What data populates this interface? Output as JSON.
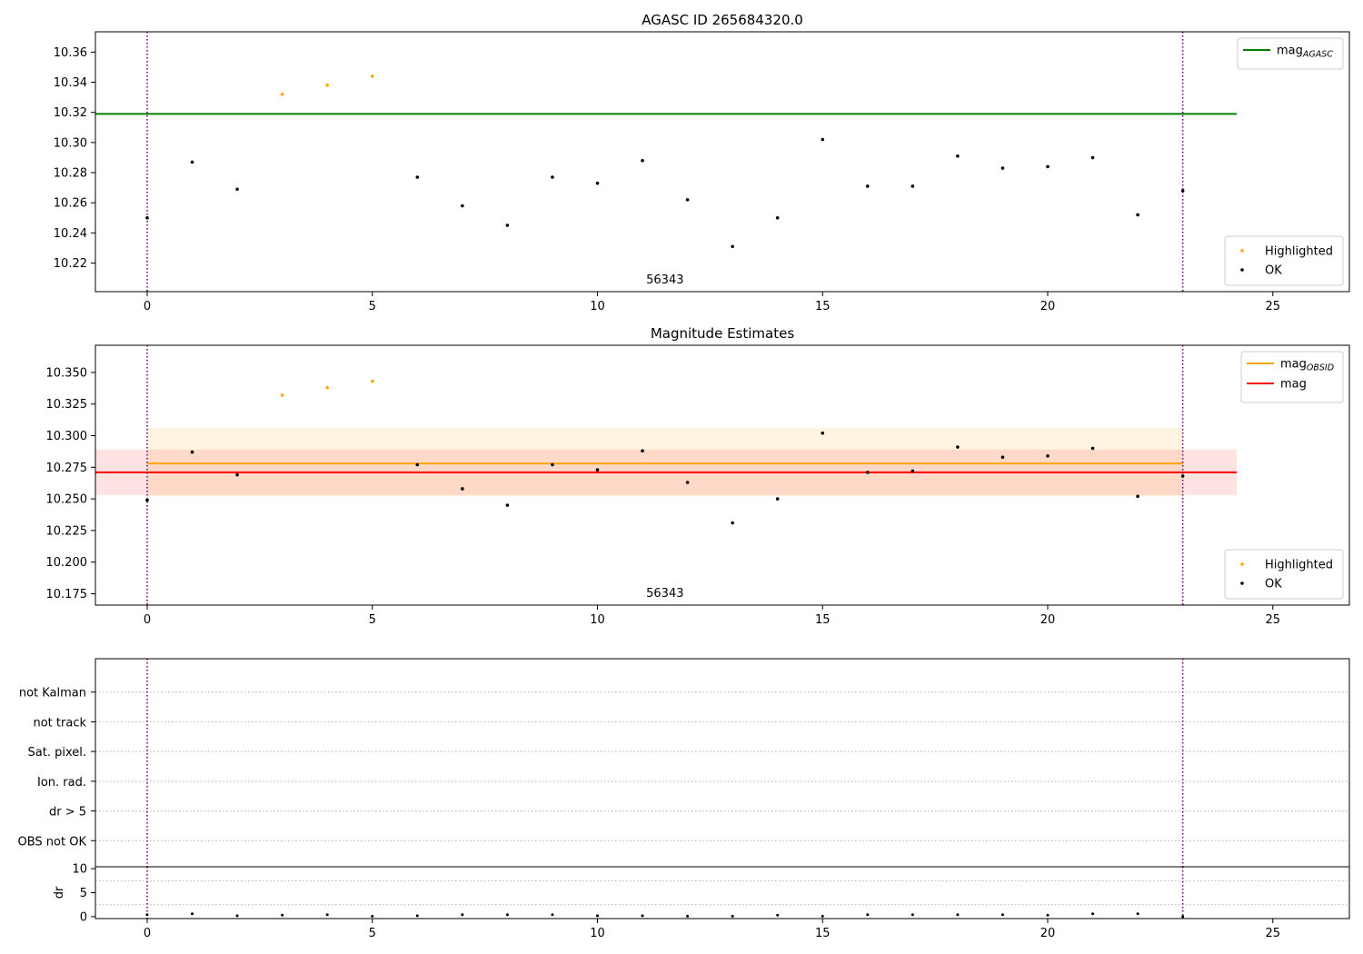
{
  "chart_data": [
    {
      "type": "scatter",
      "title": "AGASC ID 265684320.0",
      "xlim": [
        -1.15,
        26.7
      ],
      "ylim": [
        10.201,
        10.3735
      ],
      "xticks": [
        0,
        5,
        10,
        15,
        20,
        25
      ],
      "yticks": [
        10.22,
        10.24,
        10.26,
        10.28,
        10.3,
        10.32,
        10.34,
        10.36
      ],
      "ytick_decimals": 2,
      "vlines": [
        0,
        23
      ],
      "annotation": {
        "text": "56343",
        "x": 11.5
      },
      "hlines": [
        {
          "name": "mag",
          "subscript": "AGASC",
          "value": 10.319,
          "x_range": [
            -1.15,
            24.2
          ],
          "color": "#008000"
        }
      ],
      "bands": [],
      "line_legend": [
        {
          "label": "mag",
          "subscript": "AGASC",
          "color": "#008000"
        }
      ],
      "point_legend": [
        {
          "label": "Highlighted",
          "color": "#ffa500"
        },
        {
          "label": "OK",
          "color": "#000000"
        }
      ],
      "series": [
        {
          "name": "Highlighted",
          "color": "#ffa500",
          "x": [
            3,
            4,
            5
          ],
          "y": [
            10.332,
            10.338,
            10.344
          ]
        },
        {
          "name": "OK",
          "color": "#000000",
          "x": [
            0,
            1,
            2,
            6,
            7,
            8,
            9,
            10,
            11,
            12,
            13,
            14,
            15,
            16,
            17,
            18,
            19,
            20,
            21,
            22,
            23
          ],
          "y": [
            10.25,
            10.287,
            10.269,
            10.277,
            10.258,
            10.245,
            10.277,
            10.273,
            10.288,
            10.262,
            10.231,
            10.25,
            10.302,
            10.271,
            10.271,
            10.291,
            10.283,
            10.284,
            10.29,
            10.252,
            10.268
          ]
        }
      ]
    },
    {
      "type": "scatter",
      "title": "Magnitude Estimates",
      "xlim": [
        -1.15,
        26.7
      ],
      "ylim": [
        10.166,
        10.3715
      ],
      "xticks": [
        0,
        5,
        10,
        15,
        20,
        25
      ],
      "yticks": [
        10.175,
        10.2,
        10.225,
        10.25,
        10.275,
        10.3,
        10.325,
        10.35
      ],
      "ytick_decimals": 3,
      "vlines": [
        0,
        23
      ],
      "annotation": {
        "text": "56343",
        "x": 11.5
      },
      "bands": [
        {
          "low": 10.252,
          "high": 10.306,
          "x_range": [
            0,
            23
          ],
          "color": "#ffa500",
          "opacity": 0.12
        },
        {
          "low": 10.253,
          "high": 10.289,
          "x_range": [
            -1.15,
            24.2
          ],
          "color": "#ff0000",
          "opacity": 0.11
        }
      ],
      "hlines": [
        {
          "name": "mag",
          "subscript": "OBSID",
          "value": 10.278,
          "x_range": [
            0,
            23
          ],
          "color": "#ffa500"
        },
        {
          "name": "mag",
          "value": 10.271,
          "x_range": [
            -1.15,
            24.2
          ],
          "color": "#ff0000"
        }
      ],
      "line_legend": [
        {
          "label": "mag",
          "subscript": "OBSID",
          "color": "#ffa500"
        },
        {
          "label": "mag",
          "subscript": "",
          "color": "#ff0000"
        }
      ],
      "point_legend": [
        {
          "label": "Highlighted",
          "color": "#ffa500"
        },
        {
          "label": "OK",
          "color": "#000000"
        }
      ],
      "series": [
        {
          "name": "Highlighted",
          "color": "#ffa500",
          "x": [
            3,
            4,
            5
          ],
          "y": [
            10.332,
            10.338,
            10.343
          ]
        },
        {
          "name": "OK",
          "color": "#000000",
          "x": [
            0,
            1,
            2,
            6,
            7,
            8,
            9,
            10,
            11,
            12,
            13,
            14,
            15,
            16,
            17,
            18,
            19,
            20,
            21,
            22,
            23
          ],
          "y": [
            10.249,
            10.287,
            10.269,
            10.277,
            10.258,
            10.245,
            10.277,
            10.273,
            10.288,
            10.263,
            10.231,
            10.25,
            10.302,
            10.271,
            10.272,
            10.291,
            10.283,
            10.284,
            10.29,
            10.252,
            10.268
          ]
        }
      ]
    },
    {
      "type": "scatter",
      "title": "",
      "xlim": [
        -1.15,
        26.7
      ],
      "categories": [
        "OBS not OK",
        "dr > 5",
        "Ion. rad.",
        "Sat. pixel.",
        "not track",
        "not Kalman"
      ],
      "vlines": [
        0,
        23
      ],
      "series": []
    },
    {
      "type": "scatter",
      "title": "",
      "ylabel": "dr",
      "xlim": [
        -1.15,
        26.7
      ],
      "ylim": [
        -0.4,
        10.4
      ],
      "xticks": [
        0,
        5,
        10,
        15,
        20,
        25
      ],
      "yticks": [
        0,
        5,
        10
      ],
      "vlines": [
        0,
        23
      ],
      "series": [
        {
          "name": "",
          "color": "#000000",
          "x": [
            0,
            1,
            2,
            3,
            4,
            5,
            6,
            7,
            8,
            9,
            10,
            11,
            12,
            13,
            14,
            15,
            16,
            17,
            18,
            19,
            20,
            21,
            22,
            23
          ],
          "y": [
            0.4,
            0.6,
            0.2,
            0.3,
            0.4,
            0.1,
            0.2,
            0.4,
            0.4,
            0.4,
            0.2,
            0.2,
            0.1,
            0.1,
            0.3,
            0.1,
            0.4,
            0.4,
            0.4,
            0.4,
            0.3,
            0.6,
            0.6,
            0.0
          ]
        }
      ]
    }
  ]
}
